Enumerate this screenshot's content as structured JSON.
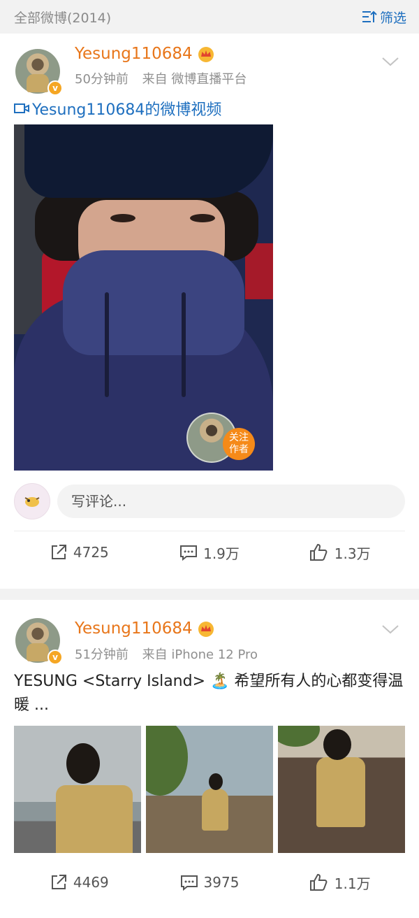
{
  "topbar": {
    "title": "全部微博(2014)",
    "filter_label": "筛选"
  },
  "posts": [
    {
      "username": "Yesung110684",
      "time": "50分钟前",
      "source": "来自 微博直播平台",
      "video_title": "Yesung110684的微博视频",
      "follow_label_1": "关注",
      "follow_label_2": "作者",
      "comment_placeholder": "写评论...",
      "reposts": "4725",
      "comments": "1.9万",
      "likes": "1.3万"
    },
    {
      "username": "Yesung110684",
      "time": "51分钟前",
      "source": "来自 iPhone 12 Pro",
      "text": "YESUNG <Starry Island> 🏝️ 希望所有人的心都变得温暖 ...",
      "reposts": "4469",
      "comments": "3975",
      "likes": "1.1万"
    }
  ],
  "icons": {
    "filter": "filter-icon",
    "crown": "crown-icon",
    "verified": "verified-badge-icon",
    "caret": "chevron-down-icon",
    "video": "video-icon",
    "repost": "repost-icon",
    "comment": "comment-icon",
    "like": "thumbs-up-icon"
  },
  "colors": {
    "username": "#e8761a",
    "link": "#1e6fbf",
    "follow": "#f58a19"
  }
}
